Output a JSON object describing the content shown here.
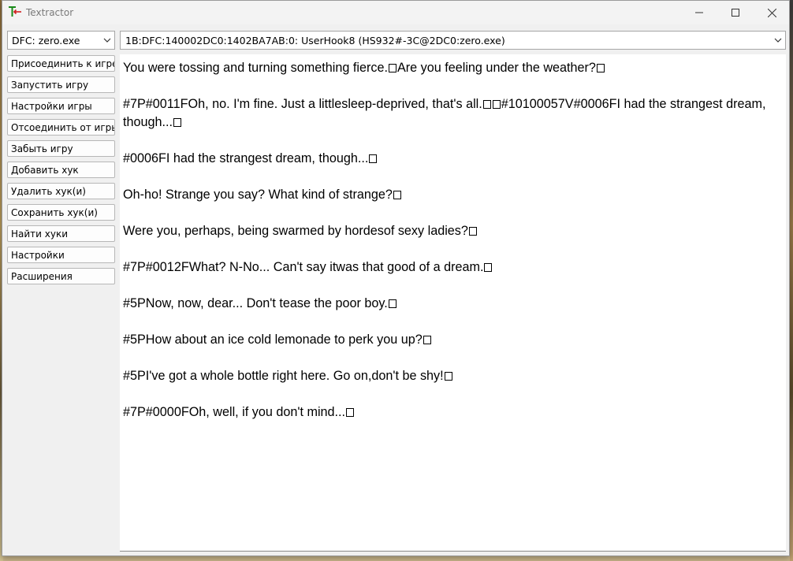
{
  "window": {
    "title": "Textractor"
  },
  "sidebar": {
    "process_select": "DFC: zero.exe",
    "buttons": [
      "Присоединить к игре",
      "Запустить игру",
      "Настройки игры",
      "Отсоединить от игры",
      "Забыть игру",
      "Добавить хук",
      "Удалить хук(и)",
      "Сохранить хук(и)",
      "Найти хуки",
      "Настройки",
      "Расширения"
    ]
  },
  "hook_select": "1B:DFC:140002DC0:1402BA7AB:0: UserHook8 (HS932#-3C@2DC0:zero.exe)",
  "text_lines": [
    [
      "You were tossing and turning something fierce.",
      "Are you feeling under the weather?",
      ""
    ],
    [
      "#7P#0011FOh, no. I'm fine. Just a littlesleep-deprived, that's all.",
      "",
      "#10100057V#0006FI had the strangest dream, though...",
      ""
    ],
    [
      "#0006FI had the strangest dream, though...",
      ""
    ],
    [
      "Oh-ho! Strange you say? What kind of strange?",
      ""
    ],
    [
      "Were you, perhaps, being swarmed by hordesof sexy ladies?",
      ""
    ],
    [
      "#7P#0012FWhat? N-No... Can't say itwas that good of a dream.",
      ""
    ],
    [
      "#5PNow, now, dear... Don't tease the poor boy.",
      ""
    ],
    [
      "#5PHow about an ice cold lemonade to perk you up?",
      ""
    ],
    [
      "#5PI've got a whole bottle right here. Go on,don't be shy!",
      ""
    ],
    [
      "#7P#0000FOh, well, if you don't mind...",
      ""
    ]
  ],
  "icons": {
    "app": "textractor-logo-icon",
    "minimize": "minimize-icon",
    "maximize": "maximize-icon",
    "close": "close-icon",
    "dropdown": "chevron-down-icon"
  }
}
